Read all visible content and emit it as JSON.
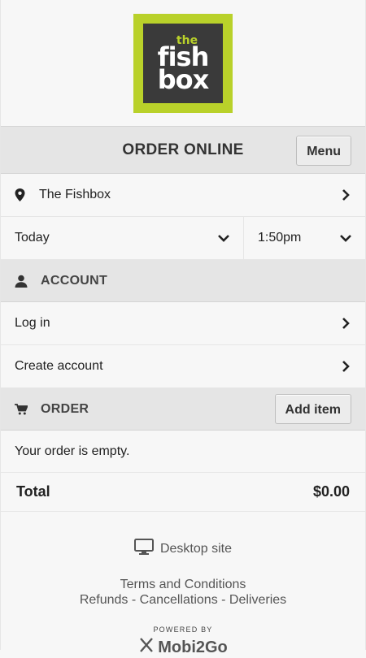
{
  "logo": {
    "line1": "the",
    "line2": "fish",
    "line3": "box",
    "bg": "#b9d12a",
    "inner": "#3a3a3a"
  },
  "header": {
    "title": "ORDER ONLINE",
    "menu_label": "Menu"
  },
  "location": {
    "label": "The Fishbox",
    "icon": "map-pin-icon"
  },
  "schedule": {
    "day": "Today",
    "time": "1:50pm"
  },
  "account": {
    "section_title": "ACCOUNT",
    "login": "Log in",
    "create": "Create account"
  },
  "order": {
    "section_title": "ORDER",
    "add_label": "Add item",
    "empty_text": "Your order is empty.",
    "total_label": "Total",
    "total_value": "$0.00"
  },
  "footer": {
    "desktop": "Desktop site",
    "terms": "Terms and Conditions",
    "refunds": "Refunds - Cancellations - Deliveries",
    "powered": "POWERED BY",
    "brand": "Mobi2Go"
  }
}
